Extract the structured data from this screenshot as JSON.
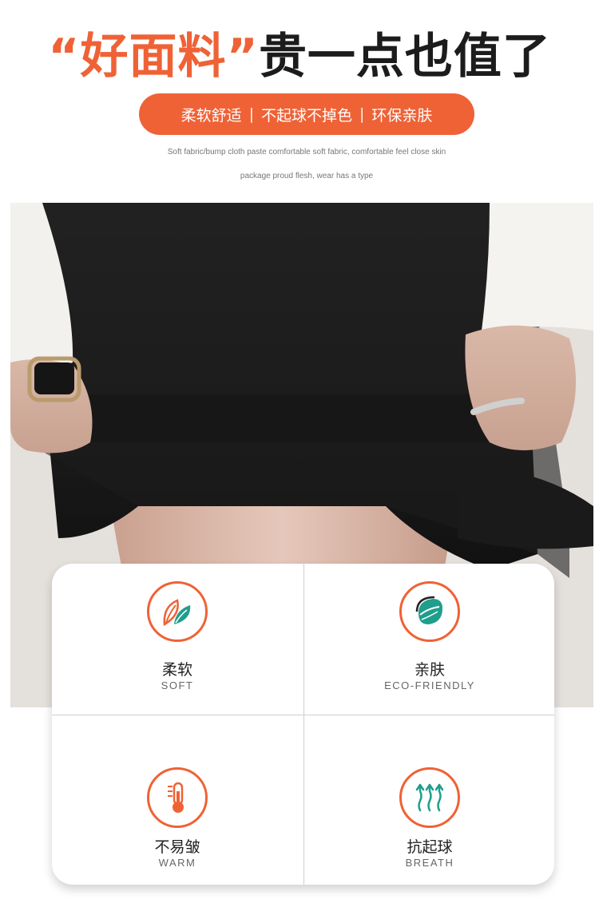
{
  "headline": {
    "accent": "“好面料”",
    "rest": "贵一点也值了"
  },
  "tagline": {
    "items": [
      "柔软舒适",
      "不起球不掉色",
      "环保亲肤"
    ],
    "separator": "|"
  },
  "description": {
    "line1": "Soft fabric/bump cloth paste comfortable soft fabric, comfortable feel close skin",
    "line2": "package proud flesh, wear has a type"
  },
  "colors": {
    "accent": "#ef6236",
    "teal": "#1f9e8c",
    "text_dark": "#1c1c1c"
  },
  "features": [
    {
      "title_zh": "柔软",
      "title_en": "SOFT",
      "icon": "leaf-icon"
    },
    {
      "title_zh": "亲肤",
      "title_en": "ECO-FRIENDLY",
      "icon": "eco-leaf-icon"
    },
    {
      "title_zh": "不易皱",
      "title_en": "WARM",
      "icon": "thermometer-icon"
    },
    {
      "title_zh": "抗起球",
      "title_en": "BREATH",
      "icon": "breathable-arrows-icon"
    }
  ]
}
